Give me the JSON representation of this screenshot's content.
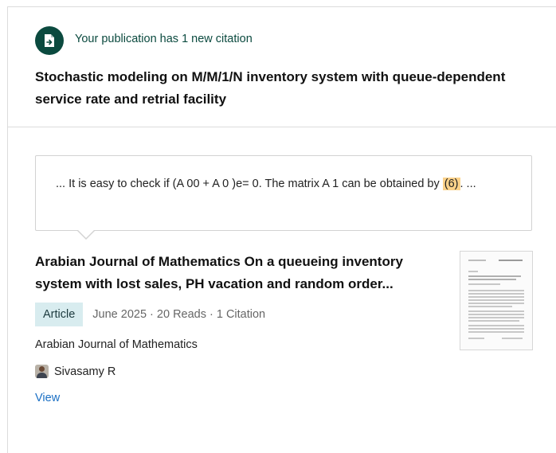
{
  "notification": {
    "text": "Your publication has 1 new citation",
    "icon": "document-arrow-icon",
    "accent_color": "#0b4a3f"
  },
  "publication": {
    "title": "Stochastic modeling on M/M/1/N inventory system with queue-dependent service rate and retrial facility"
  },
  "citation_context": {
    "before": "... It is easy to check if (A 00 + A 0 )e= 0. The matrix A 1 can be obtained by ",
    "highlight": "(6)",
    "after": ". ...",
    "highlight_color": "#fbd28a"
  },
  "citing_work": {
    "title": "Arabian Journal of Mathematics On a queueing inventory system with lost sales, PH vacation and random order...",
    "type_badge": "Article",
    "meta": "June 2025 · 20 Reads · 1 Citation",
    "journal": "Arabian Journal of Mathematics",
    "author": "Sivasamy R",
    "view_label": "View",
    "link_color": "#1a6fc4",
    "badge_color": "#d8ecef"
  }
}
